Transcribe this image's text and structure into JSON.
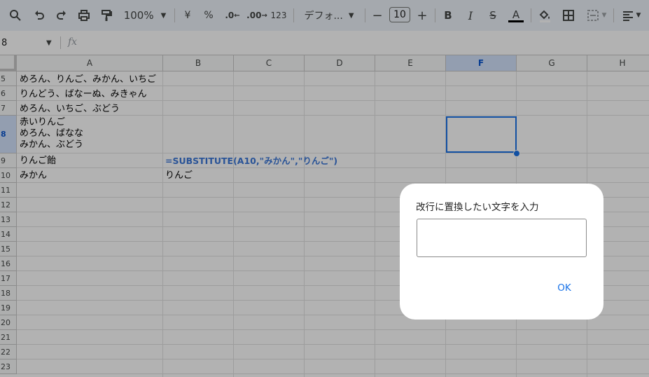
{
  "toolbar": {
    "zoom": "100%",
    "currency": "¥",
    "percent": "%",
    "decrease_decimal": ".0",
    "increase_decimal": ".00",
    "number_format": "123",
    "font_name": "デフォ...",
    "font_size": "10",
    "minus": "−",
    "plus": "+",
    "bold": "B",
    "italic": "I",
    "strike": "S",
    "text_color_glyph": "A"
  },
  "formula_bar": {
    "name_box": "8",
    "fx": "fx"
  },
  "columns": [
    "A",
    "B",
    "C",
    "D",
    "E",
    "F",
    "G",
    "H"
  ],
  "selected_column": "F",
  "rows": [
    "5",
    "6",
    "7",
    "8",
    "9",
    "10",
    "11",
    "12",
    "13",
    "14",
    "15",
    "16",
    "17",
    "18",
    "19",
    "20",
    "21",
    "22",
    "23"
  ],
  "selected_row": "8",
  "cells": {
    "A5": "めろん、りんご、みかん、いちご",
    "A6": "りんどう、ばなーぬ、みきゃん",
    "A7": "めろん、いちご、ぶどう",
    "A8": "赤いりんご\nめろん、ばなな\nみかん、ぶどう",
    "A9": "りんご飴",
    "B9": "=SUBSTITUTE(A10,\"みかん\",\"りんご\")",
    "A10": "みかん",
    "B10": "りんご"
  },
  "dialog": {
    "prompt": "改行に置換したい文字を入力",
    "input_value": "",
    "ok_label": "OK"
  },
  "colors": {
    "toolbar_bg": "#edf2fa",
    "selection": "#1a73e8",
    "formula_text": "#3c78d8",
    "header_selected_bg": "#d3e3fd"
  }
}
